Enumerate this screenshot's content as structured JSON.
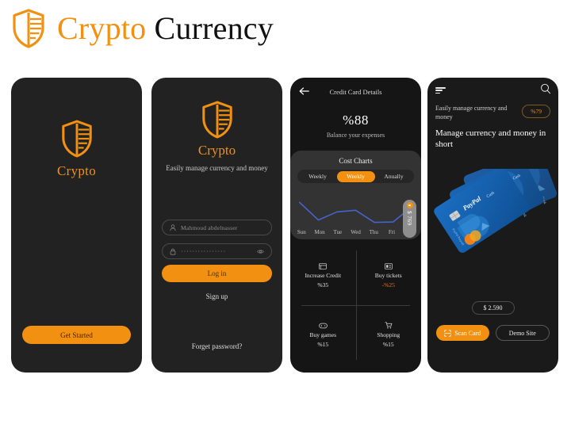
{
  "brand": {
    "word1": "Crypto",
    "word2": "Currency",
    "logo_icon": "shield-icon",
    "accent": "#F29111",
    "dark": "#111111"
  },
  "screen1": {
    "logo_icon": "shield-icon",
    "title": "Crypto",
    "cta": "Get Started"
  },
  "screen2": {
    "logo_icon": "shield-icon",
    "title": "Crypto",
    "subtitle": "Easily manage currency and money",
    "username": {
      "icon": "user-icon",
      "value": "Mahmoud abdelnasser",
      "placeholder": "Mahmoud abdelnasser"
    },
    "password": {
      "icon": "lock-icon",
      "value": "················",
      "reveal_icon": "eye-icon"
    },
    "login": "Log in",
    "signup": "Sign up",
    "forget": "Forget password?"
  },
  "screen3": {
    "back_icon": "arrow-left-icon",
    "title": "Credit Card  Details",
    "percent": "%88",
    "balance_caption": "Balance your expenses",
    "chart_title": "Cost Charts",
    "segments": [
      {
        "label": "Weekly",
        "active": false
      },
      {
        "label": "Weekly",
        "active": true
      },
      {
        "label": "Anually",
        "active": false
      }
    ],
    "marker": {
      "icon": "coin-icon",
      "value": "$ 769"
    },
    "stats": [
      {
        "icon": "credit-card-icon",
        "label": "Increase Credit",
        "value": "%35",
        "negative": false
      },
      {
        "icon": "ticket-icon",
        "label": "Buy tickets",
        "value": "-%25",
        "negative": true
      },
      {
        "icon": "gamepad-icon",
        "label": "Buy games",
        "value": "%15",
        "negative": false
      },
      {
        "icon": "cart-icon",
        "label": "Shopping",
        "value": "%15",
        "negative": false
      }
    ]
  },
  "screen4": {
    "menu_icon": "hamburger-icon",
    "search_icon": "search-icon",
    "kicker": "Easily manage currency and money",
    "badge": "%79",
    "heading": "Manage currency and money in short",
    "card_brand": "PayPal",
    "card_sub": "Cash",
    "amount": "$ 2.590",
    "scan_label": "Scan Card",
    "scan_icon": "scan-icon",
    "demo_label": "Demo Site"
  },
  "chart_data": {
    "type": "line",
    "title": "Cost Charts",
    "categories": [
      "Sun",
      "Mon",
      "Tue",
      "Wed",
      "Thu",
      "Fri",
      "Sat"
    ],
    "values": [
      880,
      430,
      640,
      680,
      370,
      380,
      769
    ],
    "series": [
      {
        "name": "Weekly cost",
        "values": [
          880,
          430,
          640,
          680,
          370,
          380,
          769
        ],
        "color": "#4663C8"
      }
    ],
    "xlabel": "",
    "ylabel": "",
    "ylim": [
      300,
      950
    ],
    "grid": false,
    "legend": false,
    "annotations": [
      {
        "x": "Sat",
        "value": "$ 769",
        "style": "pill"
      }
    ]
  }
}
